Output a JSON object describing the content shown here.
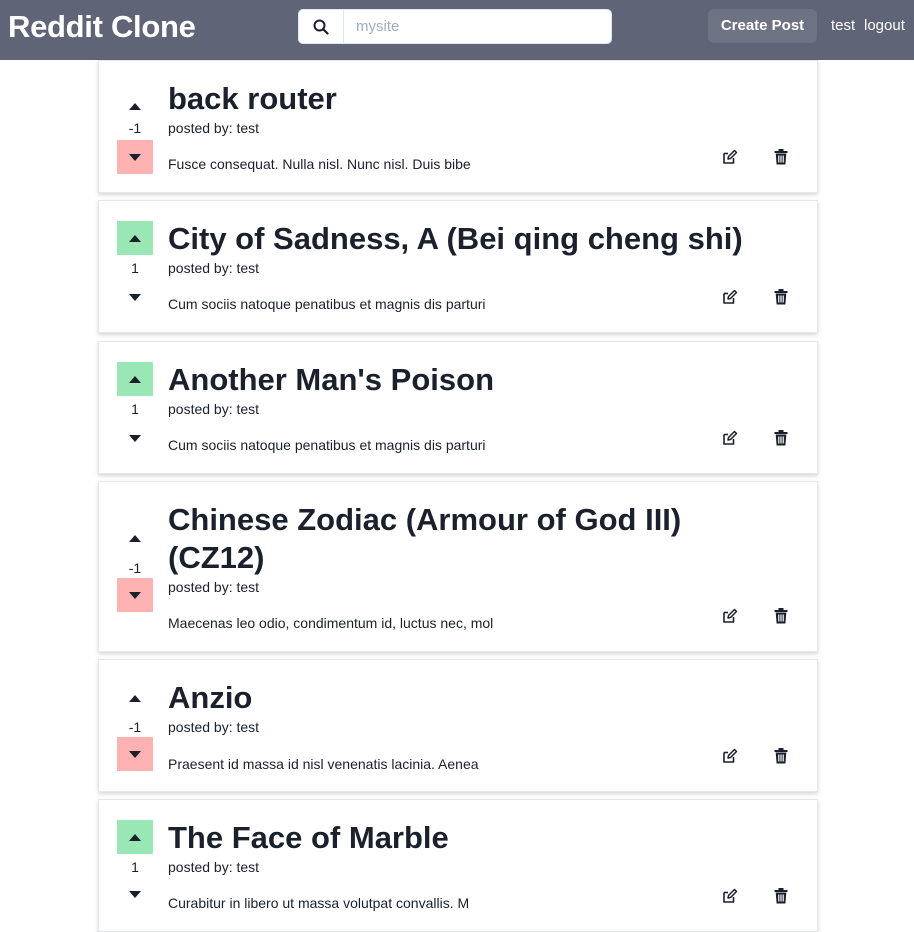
{
  "navbar": {
    "brand": "Reddit Clone",
    "search_placeholder": "mysite",
    "search_icon": "search-icon",
    "create_post_label": "Create Post",
    "username": "test",
    "logout_label": "logout"
  },
  "posts": [
    {
      "title": "back router",
      "score": "-1",
      "vote": "down",
      "posted_by": "posted by: test",
      "snippet": "Fusce consequat. Nulla nisl. Nunc nisl. Duis bibe"
    },
    {
      "title": "City of Sadness, A (Bei qing cheng shi)",
      "score": "1",
      "vote": "up",
      "posted_by": "posted by: test",
      "snippet": "Cum sociis natoque penatibus et magnis dis parturi"
    },
    {
      "title": "Another Man's Poison",
      "score": "1",
      "vote": "up",
      "posted_by": "posted by: test",
      "snippet": "Cum sociis natoque penatibus et magnis dis parturi"
    },
    {
      "title": "Chinese Zodiac (Armour of God III) (CZ12)",
      "score": "-1",
      "vote": "down",
      "posted_by": "posted by: test",
      "snippet": "Maecenas leo odio, condimentum id, luctus nec, mol"
    },
    {
      "title": "Anzio",
      "score": "-1",
      "vote": "down",
      "posted_by": "posted by: test",
      "snippet": "Praesent id massa id nisl venenatis lacinia. Aenea"
    },
    {
      "title": "The Face of Marble",
      "score": "1",
      "vote": "up",
      "posted_by": "posted by: test",
      "snippet": "Curabitur in libero ut massa volutpat convallis. M"
    }
  ],
  "icons": {
    "edit": "edit-icon",
    "delete": "trash-icon",
    "upvote": "arrow-up-icon",
    "downvote": "arrow-down-icon"
  },
  "colors": {
    "navbar": "#5f6477",
    "create_button": "#6e7384",
    "upvote_active": "#9ae6b4",
    "downvote_active": "#feb2b2",
    "text": "#1a202c"
  }
}
